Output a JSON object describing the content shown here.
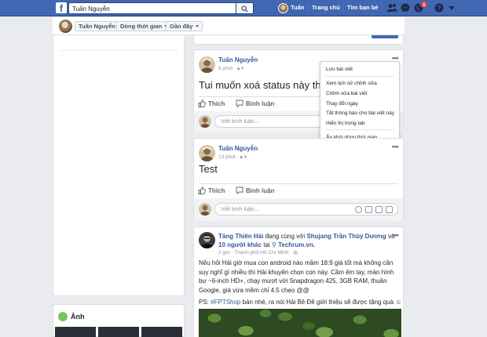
{
  "topbar": {
    "search_value": "Tuấn Nguyễn",
    "profile_name": "Tuấn",
    "home_label": "Trang chủ",
    "find_friends_label": "Tìm bạn bè",
    "notification_count": "1",
    "brand_color": "#4267b2"
  },
  "subheader": {
    "name_button": "Tuấn Nguyễn",
    "timeline_button": "Dòng thời gian",
    "recent_button": "Gần đây"
  },
  "left": {
    "photos_title": "Ảnh"
  },
  "post1": {
    "author": "Tuấn Nguyễn",
    "time": "8 phút",
    "text": "Tui muốn xoá status này thôi n",
    "like_label": "Thích",
    "comment_label": "Bình luận",
    "comment_placeholder": "Viết bình luận..."
  },
  "menu": {
    "items": [
      "Lưu bài viết",
      "Xem lịch sử chỉnh sửa",
      "Chỉnh sửa bài viết",
      "Thay đổi ngày",
      "Tắt thông báo cho bài viết này",
      "Hiển thị trong tab",
      "Ẩn khỏi dòng thời gian"
    ]
  },
  "post2": {
    "author": "Tuấn Nguyễn",
    "time": "13 phút",
    "text": "Test",
    "like_label": "Thích",
    "comment_label": "Bình luận",
    "comment_placeholder": "Viết bình luận..."
  },
  "post3": {
    "author": "Tăng Thiên Hải",
    "with_text": "đang cùng với",
    "tagged": "Shujang Trần Thùy Dương",
    "and_text": "và",
    "others": "10 người khác",
    "at_text": "tại",
    "place": "Techrum.vn.",
    "meta": "2 giờ · Thành phố Hồ Chí Minh ·",
    "body": "Nếu hỏi Hải giờ mua con android nào mầm 18:9 giá tốt mà không cần suy nghĩ gì nhiều thì Hải khuyên chọn con này. Cầm êm tay, màn hình bự ~6-inch HD+, chạy mượt với Snapdragon 425, 3GB RAM, thuần Google, giá vừa mềm chỉ 4.5 chẹo @@",
    "ps_prefix": "PS:",
    "ps_hashtag": "#FPTShop",
    "ps_text": "bán nhé, ra nói Hải Bê Đê giới thiệu sẽ được tặng quà"
  }
}
